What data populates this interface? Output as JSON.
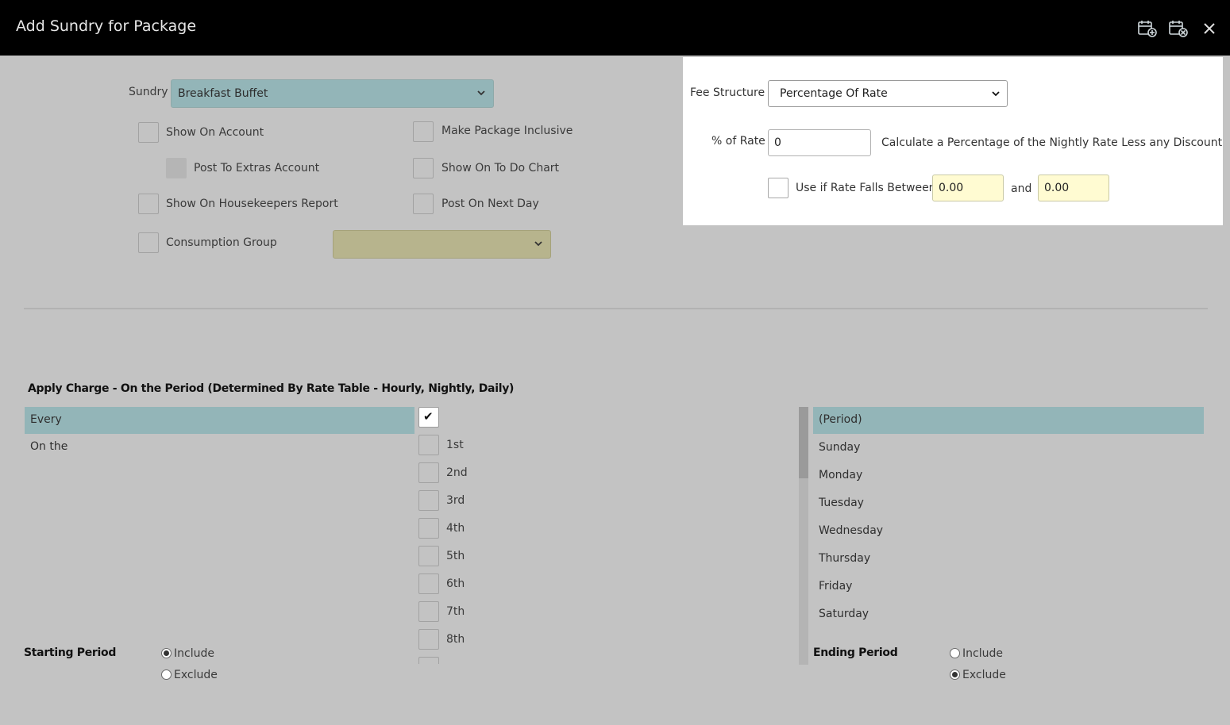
{
  "window": {
    "title": "Add Sundry for Package",
    "icons": [
      "calendar-add-icon",
      "calendar-remove-icon",
      "close-icon"
    ]
  },
  "form": {
    "sundry_label": "Sundry",
    "sundry_value": "Breakfast Buffet",
    "show_on_account": "Show On Account",
    "make_package_inclusive": "Make Package Inclusive",
    "post_to_extras_account": "Post To Extras Account",
    "show_on_to_do_chart": "Show On To Do Chart",
    "show_on_housekeepers_report": "Show On Housekeepers Report",
    "post_on_next_day": "Post On Next Day",
    "consumption_group": "Consumption Group",
    "consumption_group_value": ""
  },
  "fee": {
    "structure_label": "Fee Structure",
    "structure_value": "Percentage Of Rate",
    "pct_label": "% of Rate",
    "pct_value": "0",
    "pct_desc": "Calculate a Percentage of the Nightly Rate Less any Discount",
    "between_label": "Use if Rate Falls Between",
    "between_from": "0.00",
    "and_label": "and",
    "between_to": "0.00"
  },
  "apply": {
    "title": "Apply Charge - On the Period (Determined By Rate Table - Hourly, Nightly, Daily)",
    "modes": [
      "Every",
      "On the"
    ],
    "ordinals": [
      "1st",
      "2nd",
      "3rd",
      "4th",
      "5th",
      "6th",
      "7th",
      "8th"
    ],
    "days": [
      "(Period)",
      "Sunday",
      "Monday",
      "Tuesday",
      "Wednesday",
      "Thursday",
      "Friday",
      "Saturday"
    ],
    "starting_period": "Starting Period",
    "ending_period": "Ending Period",
    "include": "Include",
    "exclude": "Exclude",
    "starting_selected": "Include",
    "ending_selected": "Exclude"
  },
  "colors": {
    "titlebar": "#000000",
    "background": "#c3c3c3",
    "selection": "#93b5b8",
    "consumption_select": "#b7b48d",
    "yellow_input": "#fffbd2"
  }
}
